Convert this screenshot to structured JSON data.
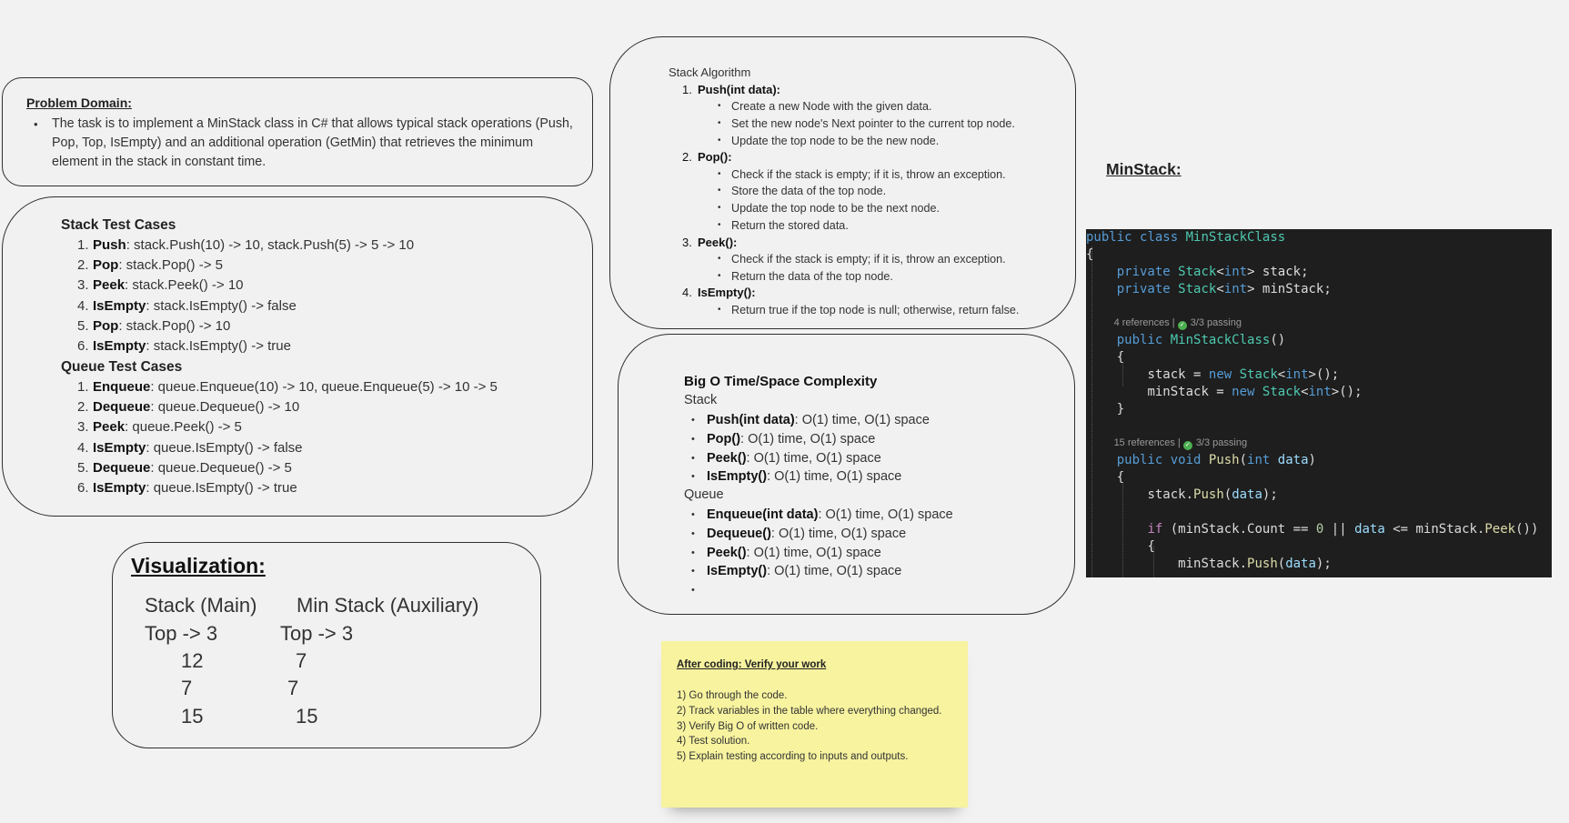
{
  "problem_domain": {
    "title": "Problem Domain:",
    "text": "The task is to implement a MinStack class in C# that allows typical stack operations (Push, Pop, Top, IsEmpty) and an additional operation (GetMin) that retrieves the minimum element in the stack in constant time."
  },
  "test_cases": {
    "stack_title": "Stack Test Cases",
    "stack": [
      {
        "num": "1.",
        "op": "Push",
        "text": ": stack.Push(10) -> 10, stack.Push(5) -> 5 -> 10"
      },
      {
        "num": "2.",
        "op": "Pop",
        "text": ": stack.Pop() -> 5"
      },
      {
        "num": "3.",
        "op": "Peek",
        "text": ": stack.Peek() -> 10"
      },
      {
        "num": "4.",
        "op": "IsEmpty",
        "text": ": stack.IsEmpty() -> false"
      },
      {
        "num": "5.",
        "op": "Pop",
        "text": ": stack.Pop() -> 10"
      },
      {
        "num": "6.",
        "op": "IsEmpty",
        "text": ": stack.IsEmpty() -> true"
      }
    ],
    "queue_title": "Queue Test Cases",
    "queue": [
      {
        "num": "1.",
        "op": "Enqueue",
        "text": ": queue.Enqueue(10) -> 10, queue.Enqueue(5) -> 10 -> 5"
      },
      {
        "num": "2.",
        "op": "Dequeue",
        "text": ": queue.Dequeue() -> 10"
      },
      {
        "num": "3.",
        "op": "Peek",
        "text": ": queue.Peek() -> 5"
      },
      {
        "num": "4.",
        "op": "IsEmpty",
        "text": ": queue.IsEmpty() -> false"
      },
      {
        "num": "5.",
        "op": "Dequeue",
        "text": ": queue.Dequeue() -> 5"
      },
      {
        "num": "6.",
        "op": "IsEmpty",
        "text": ": queue.IsEmpty() -> true"
      }
    ]
  },
  "visualization": {
    "title": "Visualization:",
    "main_header": "Stack (Main)",
    "aux_header": "Min Stack (Auxiliary)",
    "main_top": "Top -> 3",
    "aux_top": "Top -> 3",
    "main_values": [
      "12",
      "7",
      "15"
    ],
    "aux_values": [
      "7",
      "7",
      "15"
    ]
  },
  "stack_algorithm": {
    "title": "Stack Algorithm",
    "items": [
      {
        "num": "1.",
        "head": "Push(int data)",
        "suffix": ":",
        "bullets": [
          "Create a new Node with the given data.",
          "Set the new node's Next pointer to the current top node.",
          "Update the top node to be the new node."
        ]
      },
      {
        "num": "2.",
        "head": "Pop()",
        "suffix": ":",
        "bullets": [
          "Check if the stack is empty; if it is, throw an exception.",
          "Store the data of the top node.",
          "Update the top node to be the next node.",
          "Return the stored data."
        ]
      },
      {
        "num": "3.",
        "head": "Peek()",
        "suffix": ":",
        "bullets": [
          "Check if the stack is empty; if it is, throw an exception.",
          "Return the data of the top node."
        ]
      },
      {
        "num": "4.",
        "head": "IsEmpty()",
        "suffix": ":",
        "bullets": [
          "Return true if the top node is null; otherwise, return false."
        ]
      }
    ]
  },
  "big_o": {
    "title": "Big O Time/Space Complexity",
    "stack_label": "Stack",
    "stack": [
      {
        "op": "Push(int data)",
        "text": ": O(1) time, O(1) space"
      },
      {
        "op": "Pop()",
        "text": ": O(1) time, O(1) space"
      },
      {
        "op": "Peek()",
        "text": ": O(1) time, O(1) space"
      },
      {
        "op": "IsEmpty()",
        "text": ": O(1) time, O(1) space"
      }
    ],
    "queue_label": "Queue",
    "queue": [
      {
        "op": "Enqueue(int data)",
        "text": ": O(1) time, O(1) space"
      },
      {
        "op": "Dequeue()",
        "text": ": O(1) time, O(1) space"
      },
      {
        "op": "Peek()",
        "text": ": O(1) time, O(1) space"
      },
      {
        "op": "IsEmpty()",
        "text": ": O(1) time, O(1) space"
      },
      {
        "op": "",
        "text": ""
      }
    ]
  },
  "sticky_note": {
    "title": "After coding: Verify your work",
    "lines": [
      "1) Go through the code.",
      "2) Track variables in the table where everything changed.",
      "3) Verify Big O of written code.",
      "4) Test solution.",
      "5) Explain  testing according to inputs and outputs."
    ]
  },
  "minstack": {
    "title": "MinStack:",
    "code": {
      "kw_public": "public",
      "kw_class": "class",
      "kw_private": "private",
      "kw_void": "void",
      "kw_new": "new",
      "kw_int": "int",
      "kw_if": "if",
      "class_name": "MinStackClass",
      "stack_type": "Stack",
      "field_stack": "stack",
      "field_min": "minStack",
      "ref_ctor": "4 references",
      "ref_push": "15 references",
      "passing": "3/3 passing",
      "method_push": "Push",
      "method_peek": "Peek",
      "param_data": "data",
      "count": "Count",
      "zero": "0",
      "lbrace": "{",
      "rbrace": "}"
    }
  },
  "colors": {
    "background": "#f2f2f2",
    "sticky": "#f7f39f",
    "code_bg": "#1e1e1e",
    "keyword": "#569cd6",
    "type": "#4ec9b0",
    "method": "#dcdcaa",
    "param": "#9cdcfe"
  }
}
